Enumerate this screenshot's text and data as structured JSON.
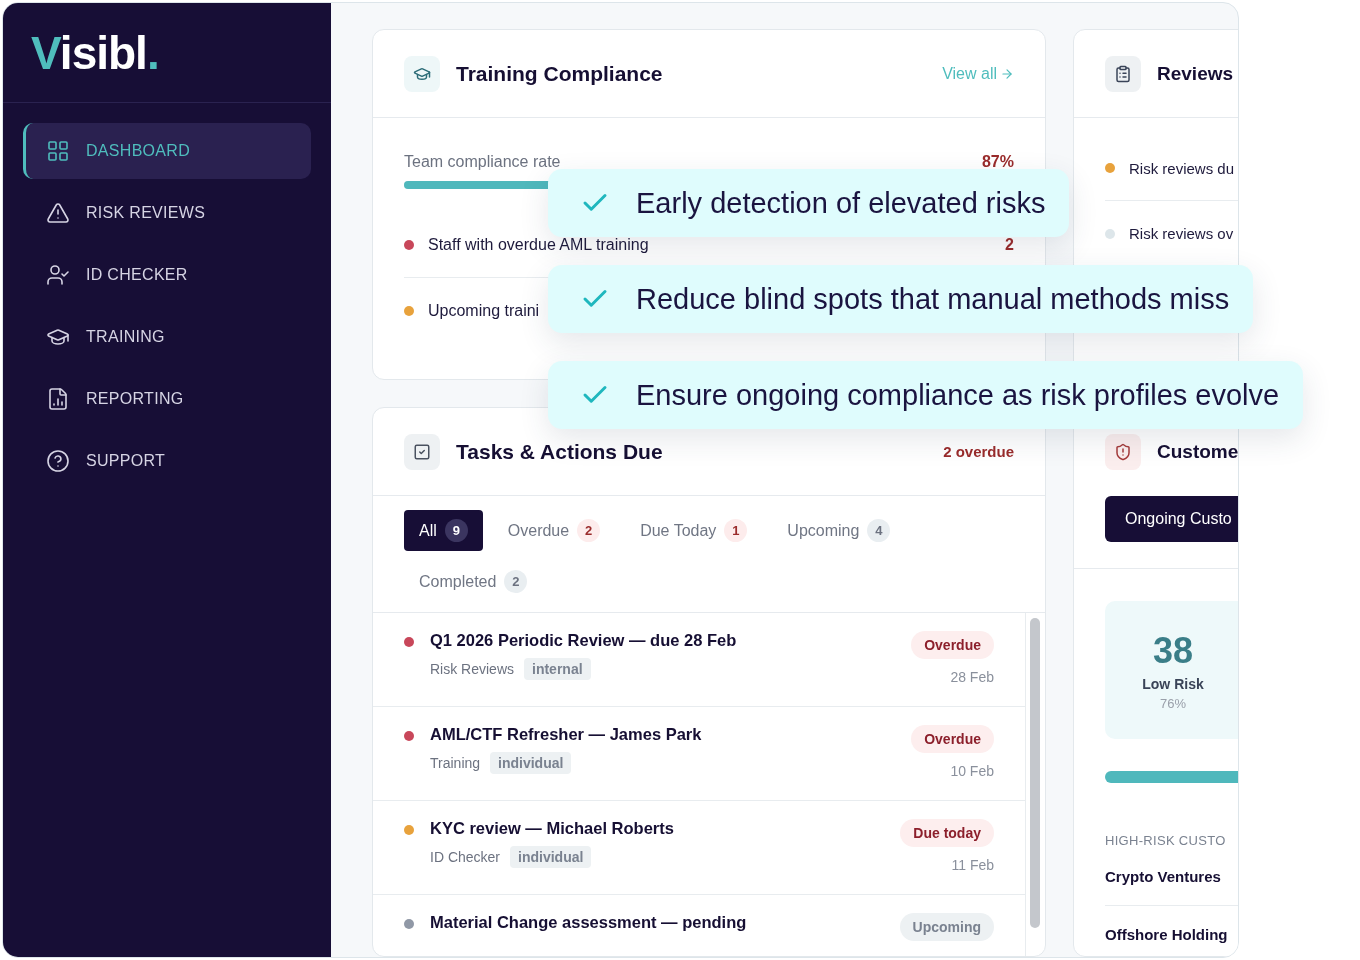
{
  "sidebar": {
    "logo": "Visibl.",
    "items": [
      {
        "label": "DASHBOARD",
        "selected": true
      },
      {
        "label": "RISK REVIEWS",
        "selected": false
      },
      {
        "label": "ID CHECKER",
        "selected": false
      },
      {
        "label": "TRAINING",
        "selected": false
      },
      {
        "label": "REPORTING",
        "selected": false
      },
      {
        "label": "SUPPORT",
        "selected": false
      }
    ]
  },
  "training": {
    "title": "Training Compliance",
    "link": "View all",
    "rate_label": "Team compliance rate",
    "rate": "87%",
    "level": 0.87,
    "items": [
      {
        "label": "Staff with overdue AML training",
        "count": "2",
        "color": "#c8475a"
      },
      {
        "label": "Upcoming traini",
        "color": "#e8a23c"
      }
    ]
  },
  "tasks": {
    "title": "Tasks & Actions Due",
    "summary": "2 overdue",
    "tabs": [
      {
        "label": "All",
        "count": "9",
        "kind": "dark",
        "selected": true
      },
      {
        "label": "Overdue",
        "count": "2",
        "kind": "alert",
        "selected": false
      },
      {
        "label": "Due Today",
        "count": "1",
        "kind": "alert",
        "selected": false
      },
      {
        "label": "Upcoming",
        "count": "4",
        "kind": "neutral",
        "selected": false
      },
      {
        "label": "Completed",
        "count": "2",
        "kind": "neutral",
        "selected": false
      }
    ],
    "rows": [
      {
        "title": "Q1 2026 Periodic Review — due 28 Feb",
        "category": "Risk Reviews",
        "tag": "internal",
        "status": "Overdue",
        "kind": "alert",
        "date": "28 Feb",
        "color": "#c8475a"
      },
      {
        "title": "AML/CTF Refresher — James Park",
        "category": "Training",
        "tag": "individual",
        "status": "Overdue",
        "kind": "alert",
        "date": "10 Feb",
        "color": "#c8475a"
      },
      {
        "title": "KYC review — Michael Roberts",
        "category": "ID Checker",
        "tag": "individual",
        "status": "Due today",
        "kind": "alert",
        "date": "11 Feb",
        "color": "#e8a23c"
      },
      {
        "title": "Material Change assessment — pending",
        "status": "Upcoming",
        "kind": "neutral",
        "color": "#9098a6"
      }
    ]
  },
  "reviews": {
    "title": "Reviews",
    "items": [
      {
        "label": "Risk reviews du",
        "color": "#e8a23c"
      },
      {
        "label": "Risk reviews ov",
        "color": "#dde6ea"
      }
    ]
  },
  "customers": {
    "title": "Custome",
    "button": "Ongoing Custo",
    "stat": {
      "value": "38",
      "label": "Low Risk",
      "share": "76%"
    },
    "section": "HIGH-RISK CUSTO",
    "list": [
      "Crypto Ventures",
      "Offshore Holding"
    ]
  },
  "callouts": [
    "Early detection of elevated risks",
    "Reduce blind spots that manual methods miss",
    "Ensure ongoing compliance as risk profiles evolve"
  ]
}
